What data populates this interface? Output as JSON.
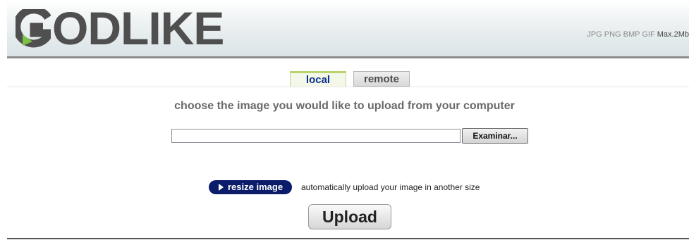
{
  "header": {
    "logo_text": "ODLIKE",
    "logo_full": "GODLIKE",
    "formats": "JPG PNG BMP GIF",
    "max_size": "Max.2Mb"
  },
  "tabs": [
    {
      "label": "local",
      "active": true
    },
    {
      "label": "remote",
      "active": false
    }
  ],
  "main": {
    "instruction": "choose the image you would like to upload from your computer",
    "file_input": {
      "value": "",
      "browse_label": "Examinar..."
    },
    "resize": {
      "button_label": "resize image",
      "description": "automatically upload your image in another size"
    },
    "upload_label": "Upload"
  },
  "colors": {
    "logo_green": "#7cc242",
    "logo_gray": "#4f4f4f",
    "tab_active_text": "#0d2f8f",
    "resize_bg": "#0b1c6b"
  },
  "icons": {
    "logo_g": "logo-g-icon",
    "resize_arrow": "play-arrow-icon"
  }
}
